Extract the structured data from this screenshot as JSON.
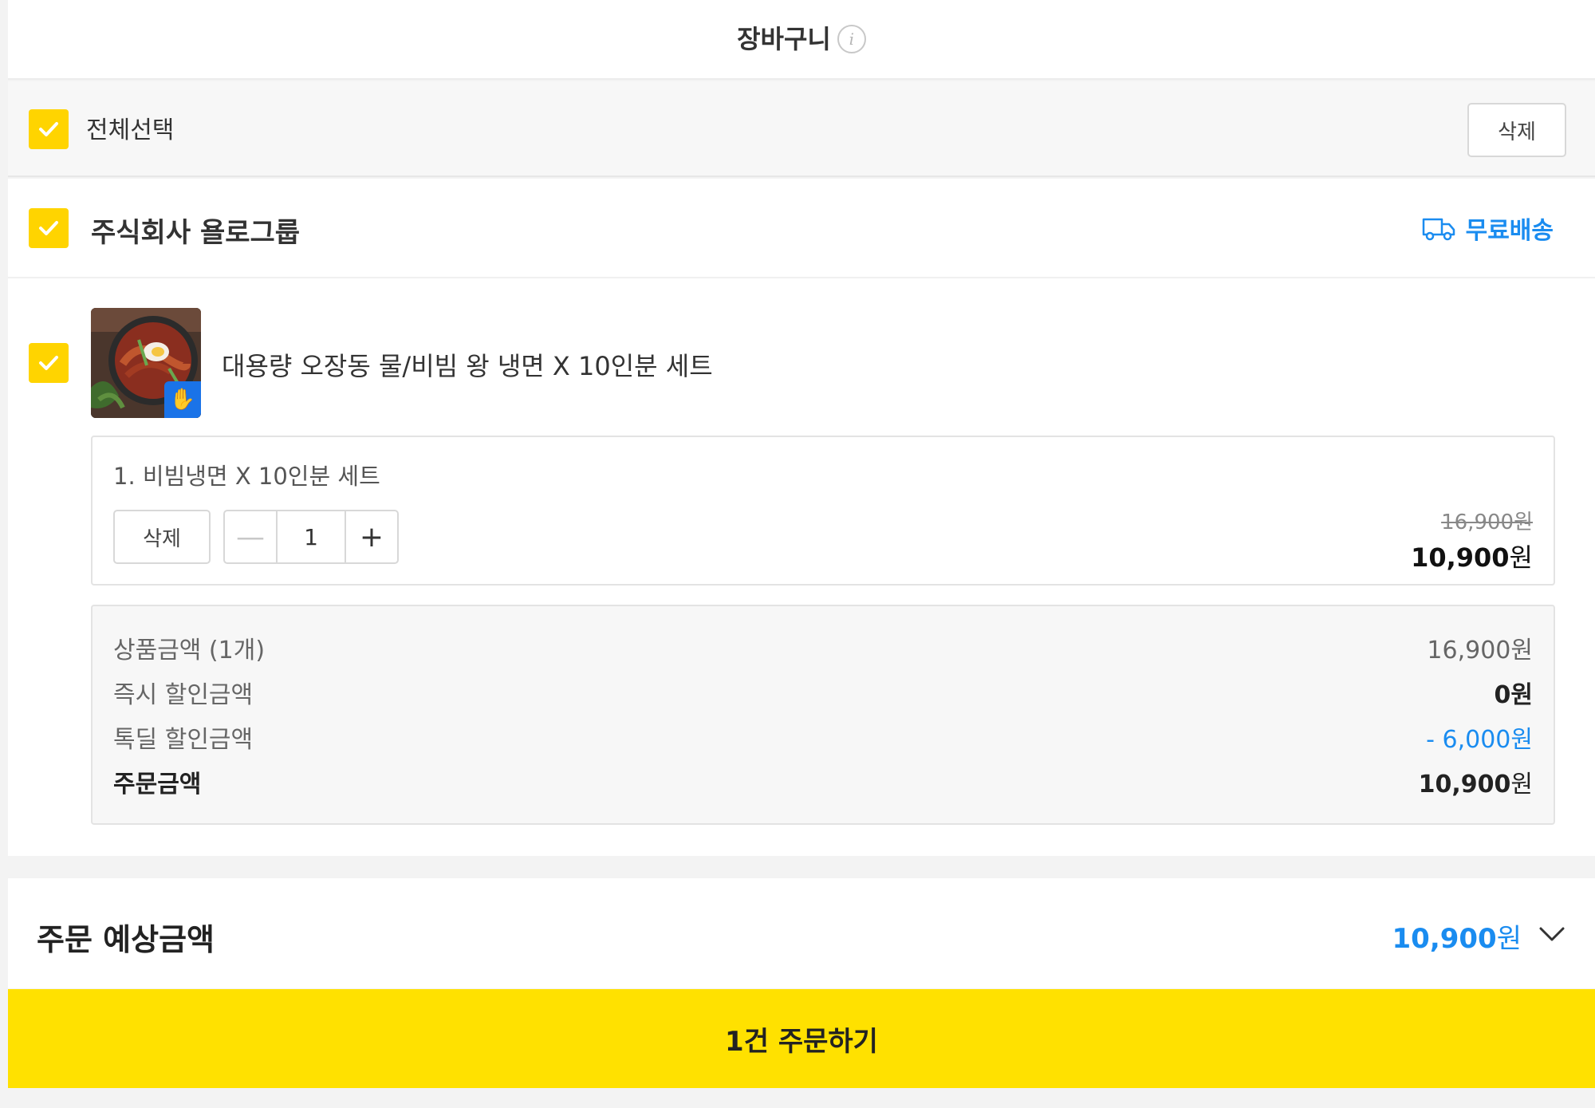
{
  "header": {
    "title": "장바구니",
    "info_icon": "i"
  },
  "select_bar": {
    "select_all_label": "전체선택",
    "delete_label": "삭제"
  },
  "seller": {
    "name": "주식회사 욜로그룹",
    "shipping_label": "무료배송"
  },
  "product": {
    "name": "대용량 오장동 물/비빔 왕 냉면 X 10인분 세트",
    "option": {
      "name": "1. 비빔냉면 X 10인분 세트",
      "delete_label": "삭제",
      "quantity": "1",
      "minus": "—",
      "plus": "+",
      "original_price": "16,900원",
      "sale_price_number": "10,900",
      "sale_price_unit": "원"
    }
  },
  "summary": {
    "rows": [
      {
        "label": "상품금액 (1개)",
        "value": "16,900원"
      },
      {
        "label": "즉시 할인금액",
        "value": "0원"
      },
      {
        "label": "톡딜 할인금액",
        "value": "- 6,000원"
      }
    ],
    "total_label": "주문금액",
    "total_number": "10,900",
    "total_unit": "원"
  },
  "estimate": {
    "label": "주문 예상금액",
    "value_number": "10,900",
    "value_unit": "원"
  },
  "order_button": {
    "label": "1건 주문하기"
  },
  "colors": {
    "accent_yellow": "#ffd400",
    "order_yellow": "#ffe100",
    "link_blue": "#1a8cf0"
  }
}
